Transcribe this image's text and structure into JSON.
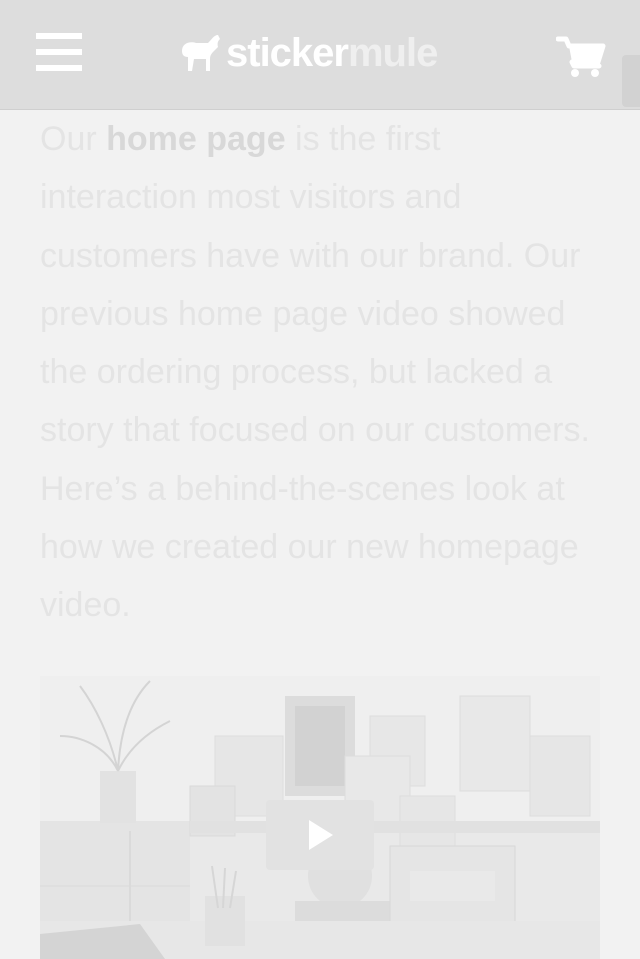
{
  "header": {
    "menu_icon": "hamburger-menu-icon",
    "logo": {
      "part_a": "sticker",
      "part_b": "mule",
      "icon": "mule-logo-icon"
    },
    "cart_icon": "shopping-cart-icon"
  },
  "article": {
    "intro_before": "Our ",
    "intro_link": "home page",
    "intro_after": " is the first interaction most visitors and customers have with our brand. Our previous home page video showed the ordering process, but lacked a story that focused on our customers. Here’s a behind-the-scenes look at how we created our new homepage video."
  },
  "video": {
    "play_icon": "play-icon"
  },
  "colors": {
    "header_bg": "#dddddd",
    "page_bg": "#f2f2f2",
    "text": "#e4e4e4",
    "link": "#d8d8d8"
  }
}
